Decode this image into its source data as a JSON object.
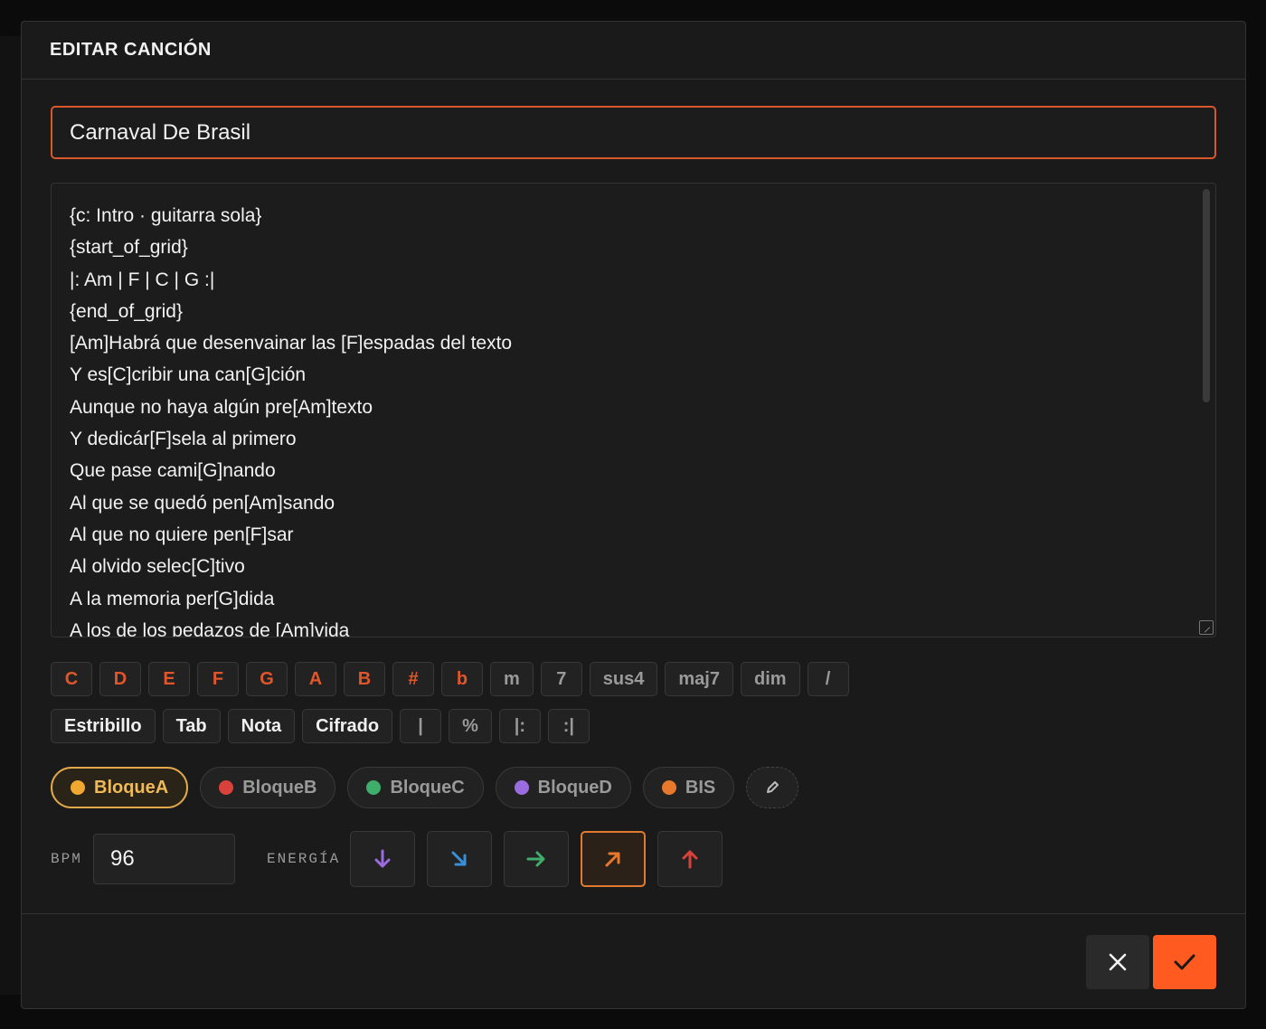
{
  "dialog": {
    "title": "EDITAR CANCIÓN",
    "song_title": "Carnaval De Brasil"
  },
  "editor": {
    "lines": [
      "{c: Intro · guitarra sola}",
      "{start_of_grid}",
      "|: Am | F | C | G :|",
      "{end_of_grid}",
      "[Am]Habrá que desenvainar las [F]espadas del texto",
      "Y es[C]cribir una can[G]ción",
      "Aunque no haya algún pre[Am]texto",
      "Y dedicár[F]sela al primero",
      "Que pase cami[G]nando",
      "Al que se quedó pen[Am]sando",
      "Al que no quiere pen[F]sar",
      "Al olvido selec[C]tivo",
      "A la memoria per[G]dida",
      "A los de los pedazos de [Am]vida"
    ]
  },
  "chord_keys": {
    "notes": [
      "C",
      "D",
      "E",
      "F",
      "G",
      "A",
      "B",
      "#",
      "b"
    ],
    "modifiers": [
      "m",
      "7",
      "sus4",
      "maj7",
      "dim",
      "/"
    ]
  },
  "tag_keys": {
    "tags": [
      "Estribillo",
      "Tab",
      "Nota",
      "Cifrado"
    ],
    "symbols": [
      "|",
      "%",
      "|:",
      ":|"
    ]
  },
  "blocks": [
    {
      "label": "BloqueA",
      "color": "#f0a830",
      "active": true
    },
    {
      "label": "BloqueB",
      "color": "#d9413b",
      "active": false
    },
    {
      "label": "BloqueC",
      "color": "#3fae6a",
      "active": false
    },
    {
      "label": "BloqueD",
      "color": "#9b6be0",
      "active": false
    },
    {
      "label": "BIS",
      "color": "#e8792c",
      "active": false
    }
  ],
  "edit_blocks_icon": "pencil-icon",
  "tempo": {
    "bpm_label": "BPM",
    "bpm_value": "96",
    "energy_label": "ENERGÍA",
    "energy_levels": [
      {
        "icon": "arrow-down-icon",
        "color": "#9b6be0"
      },
      {
        "icon": "arrow-down-right-icon",
        "color": "#3b8fd9"
      },
      {
        "icon": "arrow-right-icon",
        "color": "#3fae6a"
      },
      {
        "icon": "arrow-up-right-icon",
        "color": "#e8792c"
      },
      {
        "icon": "arrow-up-icon",
        "color": "#d9413b"
      }
    ],
    "energy_selected_index": 3
  },
  "footer": {
    "cancel_icon": "close-icon",
    "save_icon": "check-icon"
  },
  "colors": {
    "accent": "#ff5a1f",
    "note_key": "#e0562a"
  }
}
